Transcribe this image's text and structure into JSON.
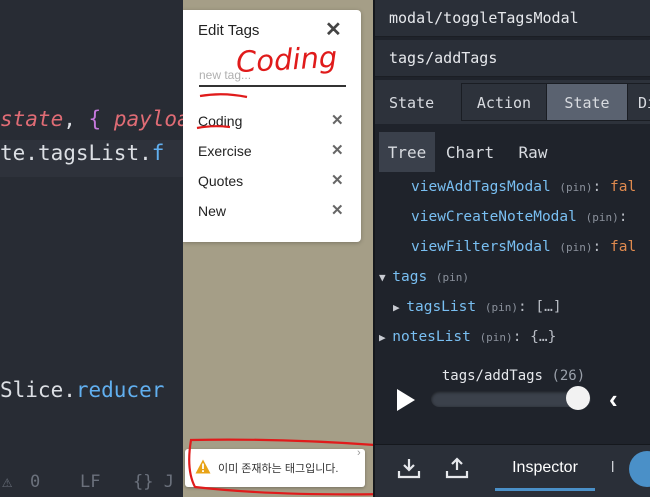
{
  "editor": {
    "lines": [
      {
        "parts": [
          {
            "t": "state",
            "c": "c-var"
          },
          {
            "t": ", ",
            "c": "c-prop"
          },
          {
            "t": "{",
            "c": "c-kw"
          },
          {
            "t": " ",
            "c": "c-prop"
          },
          {
            "t": "payloa",
            "c": "c-var"
          }
        ]
      },
      {
        "parts": [
          {
            "t": "te.",
            "c": "c-prop"
          },
          {
            "t": "tagsList.",
            "c": "c-prop"
          },
          {
            "t": "f",
            "c": "c-fn"
          }
        ]
      },
      {
        "parts": [
          {
            "t": "Slice.",
            "c": "c-prop"
          },
          {
            "t": "reducer",
            "c": "c-fn"
          }
        ]
      }
    ],
    "status": {
      "warnings": "0",
      "line_ending": "LF",
      "language": "{} J"
    }
  },
  "modal": {
    "title": "Edit Tags",
    "close_icon": "close-icon",
    "input_placeholder": "new tag...",
    "input_value": "",
    "tags": [
      "Coding",
      "Exercise",
      "Quotes",
      "New"
    ]
  },
  "toast": {
    "message": "이미 존재하는 태그입니다.",
    "icon": "warning-icon",
    "warning_color": "#e8a317"
  },
  "devtools": {
    "actions": [
      "modal/toggleTagsModal",
      "tags/addTags"
    ],
    "header_label": "State",
    "tabs": [
      "Action",
      "State",
      "Di"
    ],
    "active_tab": "State",
    "subtabs": [
      "Tree",
      "Chart",
      "Raw"
    ],
    "active_subtab": "Tree",
    "tree": [
      {
        "arrow": "",
        "key": "viewAddTagsModal",
        "pin": "(pin)",
        "sep": ": ",
        "value": "fal",
        "kind": "false"
      },
      {
        "arrow": "",
        "key": "viewCreateNoteModal",
        "pin": "(pin)",
        "sep": ": ",
        "value": "",
        "kind": "false"
      },
      {
        "arrow": "",
        "key": "viewFiltersModal",
        "pin": "(pin)",
        "sep": ": ",
        "value": "fal",
        "kind": "false"
      },
      {
        "arrow": "▼",
        "key": "tags",
        "pin": "(pin)",
        "sep": "",
        "value": "",
        "kind": "group"
      },
      {
        "arrow": "▶",
        "key": "tagsList",
        "pin": "(pin)",
        "sep": ": ",
        "value": "[…]",
        "kind": "punct"
      },
      {
        "arrow": "▶",
        "key": "notesList",
        "pin": "(pin)",
        "sep": ": ",
        "value": "{…}",
        "kind": "punct"
      }
    ],
    "slider_action": "tags/addTags",
    "slider_count": "(26)",
    "slider_position": 0.92,
    "inspector_label": "Inspector",
    "extra_label": "l"
  },
  "annotation": {
    "handwritten_text": "Coding",
    "color": "#e01b1b"
  }
}
